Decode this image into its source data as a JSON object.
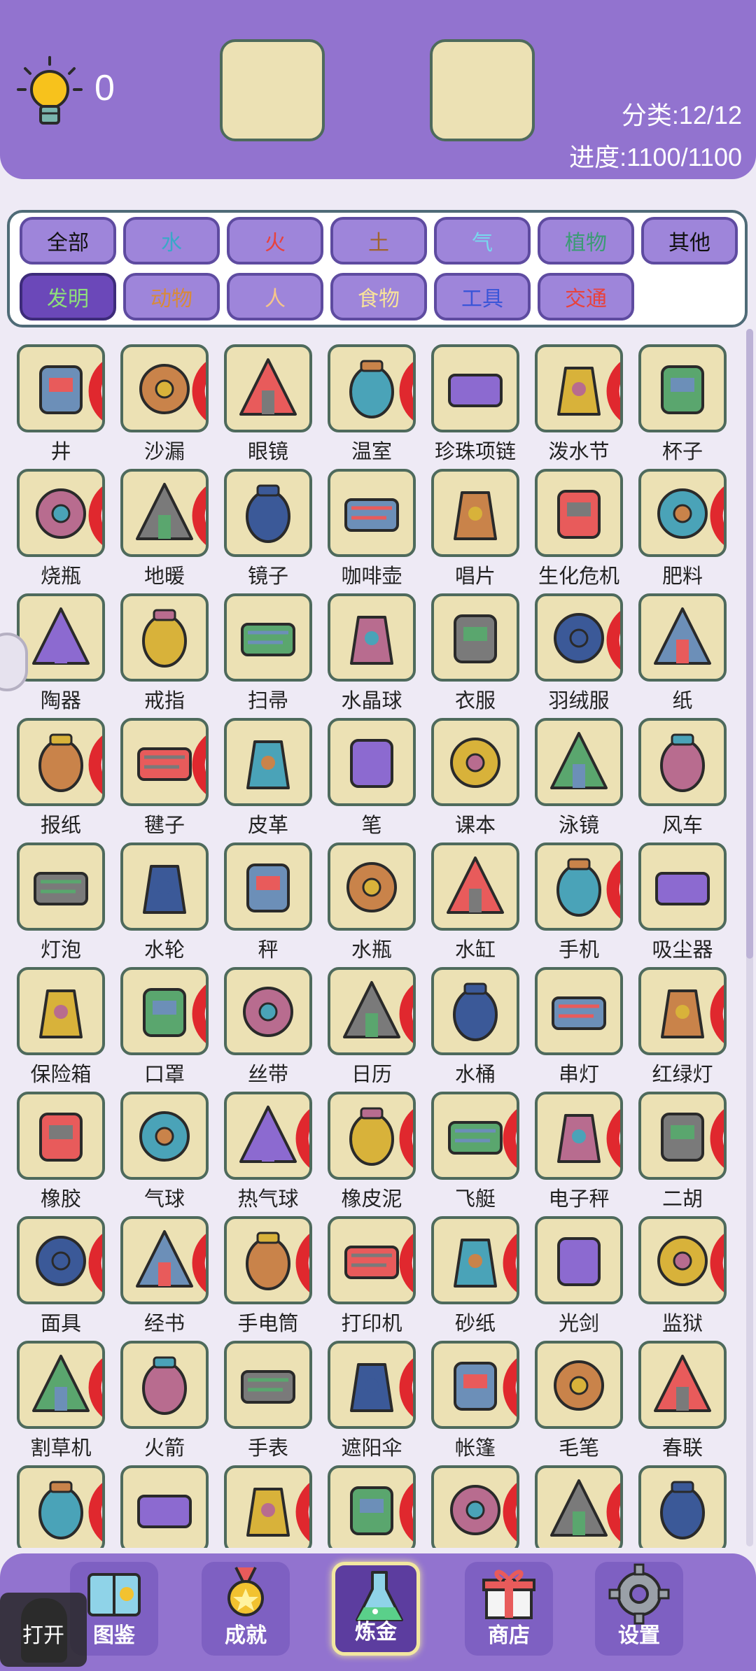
{
  "header": {
    "hint_count": "0",
    "category_progress": "分类:12/12",
    "overall_progress": "进度:1100/1100"
  },
  "filters": [
    {
      "label": "全部",
      "color": "#111111"
    },
    {
      "label": "水",
      "color": "#3aa8c8"
    },
    {
      "label": "火",
      "color": "#e8423c"
    },
    {
      "label": "土",
      "color": "#a0642d"
    },
    {
      "label": "气",
      "color": "#78d8ee"
    },
    {
      "label": "植物",
      "color": "#3b9b74"
    },
    {
      "label": "其他",
      "color": "#111111"
    },
    {
      "label": "发明",
      "color": "#8ee07a",
      "active": true
    },
    {
      "label": "动物",
      "color": "#d88a3a"
    },
    {
      "label": "人",
      "color": "#f5c58a"
    },
    {
      "label": "食物",
      "color": "#f8e39a"
    },
    {
      "label": "工具",
      "color": "#3a55d8"
    },
    {
      "label": "交通",
      "color": "#e8423c"
    }
  ],
  "items": [
    {
      "name": "井",
      "icon": "well-icon",
      "banned": true
    },
    {
      "name": "沙漏",
      "icon": "hourglass-icon",
      "banned": true
    },
    {
      "name": "眼镜",
      "icon": "glasses-icon",
      "banned": false
    },
    {
      "name": "温室",
      "icon": "greenhouse-icon",
      "banned": true
    },
    {
      "name": "珍珠项链",
      "icon": "pearl-necklace-icon",
      "banned": false
    },
    {
      "name": "泼水节",
      "icon": "water-festival-icon",
      "banned": true
    },
    {
      "name": "杯子",
      "icon": "cup-icon",
      "banned": false
    },
    {
      "name": "烧瓶",
      "icon": "flask-icon",
      "banned": true
    },
    {
      "name": "地暖",
      "icon": "floor-heating-icon",
      "banned": true
    },
    {
      "name": "镜子",
      "icon": "mirror-icon",
      "banned": false
    },
    {
      "name": "咖啡壶",
      "icon": "coffee-pot-icon",
      "banned": false
    },
    {
      "name": "唱片",
      "icon": "vinyl-record-icon",
      "banned": false
    },
    {
      "name": "生化危机",
      "icon": "biohazard-icon",
      "banned": false
    },
    {
      "name": "肥料",
      "icon": "fertilizer-icon",
      "banned": true
    },
    {
      "name": "陶器",
      "icon": "pottery-icon",
      "banned": false
    },
    {
      "name": "戒指",
      "icon": "ring-icon",
      "banned": false
    },
    {
      "name": "扫帚",
      "icon": "broom-icon",
      "banned": false
    },
    {
      "name": "水晶球",
      "icon": "crystal-ball-icon",
      "banned": false
    },
    {
      "name": "衣服",
      "icon": "clothes-icon",
      "banned": false
    },
    {
      "name": "羽绒服",
      "icon": "down-jacket-icon",
      "banned": true
    },
    {
      "name": "纸",
      "icon": "paper-icon",
      "banned": false
    },
    {
      "name": "报纸",
      "icon": "newspaper-icon",
      "banned": true
    },
    {
      "name": "毽子",
      "icon": "shuttlecock-icon",
      "banned": true
    },
    {
      "name": "皮革",
      "icon": "leather-icon",
      "banned": false
    },
    {
      "name": "笔",
      "icon": "pen-icon",
      "banned": false
    },
    {
      "name": "课本",
      "icon": "textbook-icon",
      "banned": false
    },
    {
      "name": "泳镜",
      "icon": "swim-goggles-icon",
      "banned": false
    },
    {
      "name": "风车",
      "icon": "windmill-icon",
      "banned": false
    },
    {
      "name": "灯泡",
      "icon": "light-bulb-icon",
      "banned": false
    },
    {
      "name": "水轮",
      "icon": "water-wheel-icon",
      "banned": false
    },
    {
      "name": "秤",
      "icon": "scale-icon",
      "banned": false
    },
    {
      "name": "水瓶",
      "icon": "water-bottle-icon",
      "banned": false
    },
    {
      "name": "水缸",
      "icon": "water-jar-icon",
      "banned": false
    },
    {
      "name": "手机",
      "icon": "phone-icon",
      "banned": true
    },
    {
      "name": "吸尘器",
      "icon": "vacuum-icon",
      "banned": false
    },
    {
      "name": "保险箱",
      "icon": "safe-icon",
      "banned": false
    },
    {
      "name": "口罩",
      "icon": "mask-icon",
      "banned": true
    },
    {
      "name": "丝带",
      "icon": "ribbon-icon",
      "banned": false
    },
    {
      "name": "日历",
      "icon": "calendar-icon",
      "banned": true
    },
    {
      "name": "水桶",
      "icon": "bucket-icon",
      "banned": false
    },
    {
      "name": "串灯",
      "icon": "string-lights-icon",
      "banned": false
    },
    {
      "name": "红绿灯",
      "icon": "traffic-light-icon",
      "banned": true
    },
    {
      "name": "橡胶",
      "icon": "rubber-gloves-icon",
      "banned": false
    },
    {
      "name": "气球",
      "icon": "balloons-icon",
      "banned": false
    },
    {
      "name": "热气球",
      "icon": "hot-air-balloon-icon",
      "banned": true
    },
    {
      "name": "橡皮泥",
      "icon": "plasticine-icon",
      "banned": true
    },
    {
      "name": "飞艇",
      "icon": "airship-icon",
      "banned": true
    },
    {
      "name": "电子秤",
      "icon": "electronic-scale-icon",
      "banned": true
    },
    {
      "name": "二胡",
      "icon": "erhu-icon",
      "banned": true
    },
    {
      "name": "面具",
      "icon": "carnival-mask-icon",
      "banned": true
    },
    {
      "name": "经书",
      "icon": "scripture-icon",
      "banned": true
    },
    {
      "name": "手电筒",
      "icon": "flashlight-icon",
      "banned": true
    },
    {
      "name": "打印机",
      "icon": "printer-icon",
      "banned": true
    },
    {
      "name": "砂纸",
      "icon": "sandpaper-icon",
      "banned": true
    },
    {
      "name": "光剑",
      "icon": "lightsaber-icon",
      "banned": false
    },
    {
      "name": "监狱",
      "icon": "prison-icon",
      "banned": true
    },
    {
      "name": "割草机",
      "icon": "lawn-mower-icon",
      "banned": true
    },
    {
      "name": "火箭",
      "icon": "rocket-icon",
      "banned": false
    },
    {
      "name": "手表",
      "icon": "watch-icon",
      "banned": false
    },
    {
      "name": "遮阳伞",
      "icon": "parasol-icon",
      "banned": true
    },
    {
      "name": "帐篷",
      "icon": "tent-icon",
      "banned": true
    },
    {
      "name": "毛笔",
      "icon": "brush-icon",
      "banned": false
    },
    {
      "name": "春联",
      "icon": "couplets-icon",
      "banned": false
    },
    {
      "name": "",
      "icon": "spring-festival-icon",
      "banned": true
    },
    {
      "name": "",
      "icon": "lanterns-icon",
      "banned": false
    },
    {
      "name": "",
      "icon": "sunglasses-icon",
      "banned": true
    },
    {
      "name": "",
      "icon": "ski-helmet-icon",
      "banned": true
    },
    {
      "name": "",
      "icon": "milk-tea-icon",
      "banned": true
    },
    {
      "name": "",
      "icon": "air-conditioner-icon",
      "banned": true
    },
    {
      "name": "",
      "icon": "desk-lamp-icon",
      "banned": false
    }
  ],
  "nav": [
    {
      "label": "图鉴",
      "icon": "encyclopedia-icon"
    },
    {
      "label": "成就",
      "icon": "medal-icon"
    },
    {
      "label": "炼金",
      "icon": "potion-flask-icon",
      "active": true
    },
    {
      "label": "商店",
      "icon": "gift-box-icon"
    },
    {
      "label": "设置",
      "icon": "gear-icon"
    }
  ],
  "floating": {
    "open_label": "打开"
  }
}
